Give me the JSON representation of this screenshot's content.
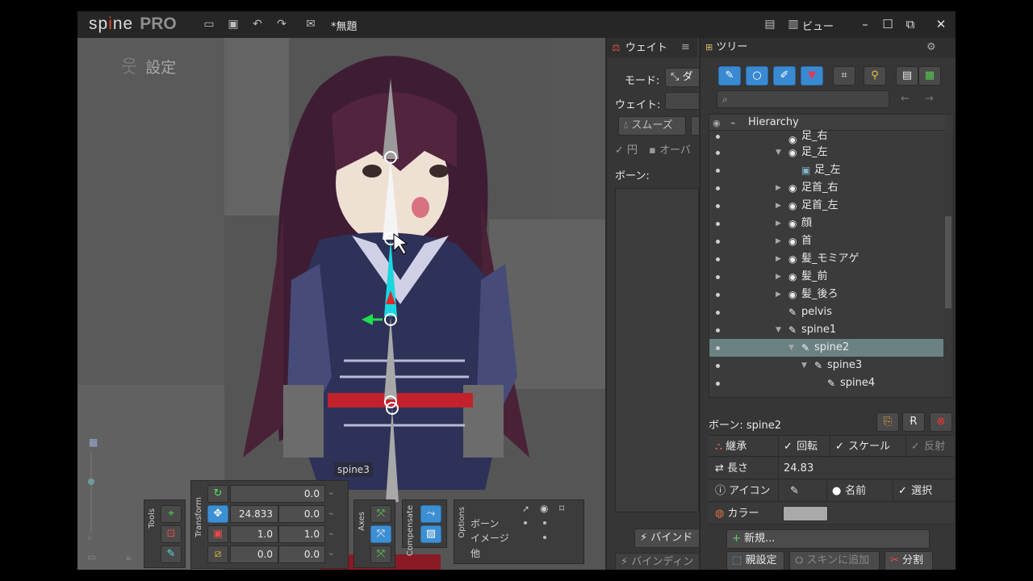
{
  "app": {
    "logo_main": "sp",
    "logo_mid": "i",
    "logo_tail": "ne",
    "logo_pro": "PRO",
    "document_title": "*無題",
    "view_menu": "ビュー",
    "accent_color": "#3d8fd3"
  },
  "viewport": {
    "mode_label": "設定",
    "hover_bone_label": "spine3"
  },
  "tools_panel": {
    "tools_label": "Tools",
    "transform_label": "Transform",
    "axes_label": "Axes",
    "compensate_label": "Compensate",
    "options_label": "Options",
    "rotate_value": "0.0",
    "translate_x": "24.833",
    "translate_y": "0.0",
    "scale_x": "1.0",
    "scale_y": "1.0",
    "shear_x": "0.0",
    "shear_y": "0.0",
    "options_rows": [
      "ボーン",
      "イメージ",
      "他"
    ]
  },
  "weights_panel": {
    "title": "ウェイト",
    "mode_label": "モード:",
    "mode_value": "ダ",
    "weight_label": "ウェイト:",
    "smooth_button": "スムーズ",
    "circle_option": "円",
    "overlay_option": "オーバ",
    "bones_label": "ボーン:",
    "bind_button": "バインド",
    "binding_button": "バインディン"
  },
  "tree_panel": {
    "title": "ツリー",
    "search_placeholder": "",
    "hierarchy_header": "Hierarchy",
    "rows": [
      {
        "label": "足_右",
        "icon": "bone-circle",
        "indent": 1,
        "expand": ""
      },
      {
        "label": "足_左",
        "icon": "bone-circle",
        "indent": 1,
        "expand": "open"
      },
      {
        "label": "足_左",
        "icon": "image-slot",
        "indent": 2,
        "expand": ""
      },
      {
        "label": "足首_右",
        "icon": "bone-circle",
        "indent": 1,
        "expand": "closed"
      },
      {
        "label": "足首_左",
        "icon": "bone-circle",
        "indent": 1,
        "expand": "closed"
      },
      {
        "label": "顔",
        "icon": "bone-circle",
        "indent": 1,
        "expand": "closed"
      },
      {
        "label": "首",
        "icon": "bone-circle",
        "indent": 1,
        "expand": "closed"
      },
      {
        "label": "髪_モミアゲ",
        "icon": "bone-circle",
        "indent": 1,
        "expand": "closed"
      },
      {
        "label": "髪_前",
        "icon": "bone-circle",
        "indent": 1,
        "expand": "closed"
      },
      {
        "label": "髪_後ろ",
        "icon": "bone-circle",
        "indent": 1,
        "expand": "closed"
      },
      {
        "label": "pelvis",
        "icon": "bone",
        "indent": 1,
        "expand": ""
      },
      {
        "label": "spine1",
        "icon": "bone",
        "indent": 1,
        "expand": "open"
      },
      {
        "label": "spine2",
        "icon": "bone",
        "indent": 2,
        "expand": "open",
        "selected": true
      },
      {
        "label": "spine3",
        "icon": "bone",
        "indent": 3,
        "expand": "open"
      },
      {
        "label": "spine4",
        "icon": "bone",
        "indent": 4,
        "expand": ""
      }
    ]
  },
  "bone_props": {
    "title": "ボーン: spine2",
    "inherit_label": "継承",
    "rotation_label": "回転",
    "scale_label": "スケール",
    "reflect_label": "反射",
    "length_label": "長さ",
    "length_value": "24.83",
    "icon_label": "アイコン",
    "name_label": "名前",
    "select_label": "選択",
    "color_label": "カラー",
    "color_value": "#a9a9a9",
    "new_button": "新規...",
    "parent_button": "親設定",
    "add_skin_button": "スキンに追加",
    "split_button": "分割"
  }
}
